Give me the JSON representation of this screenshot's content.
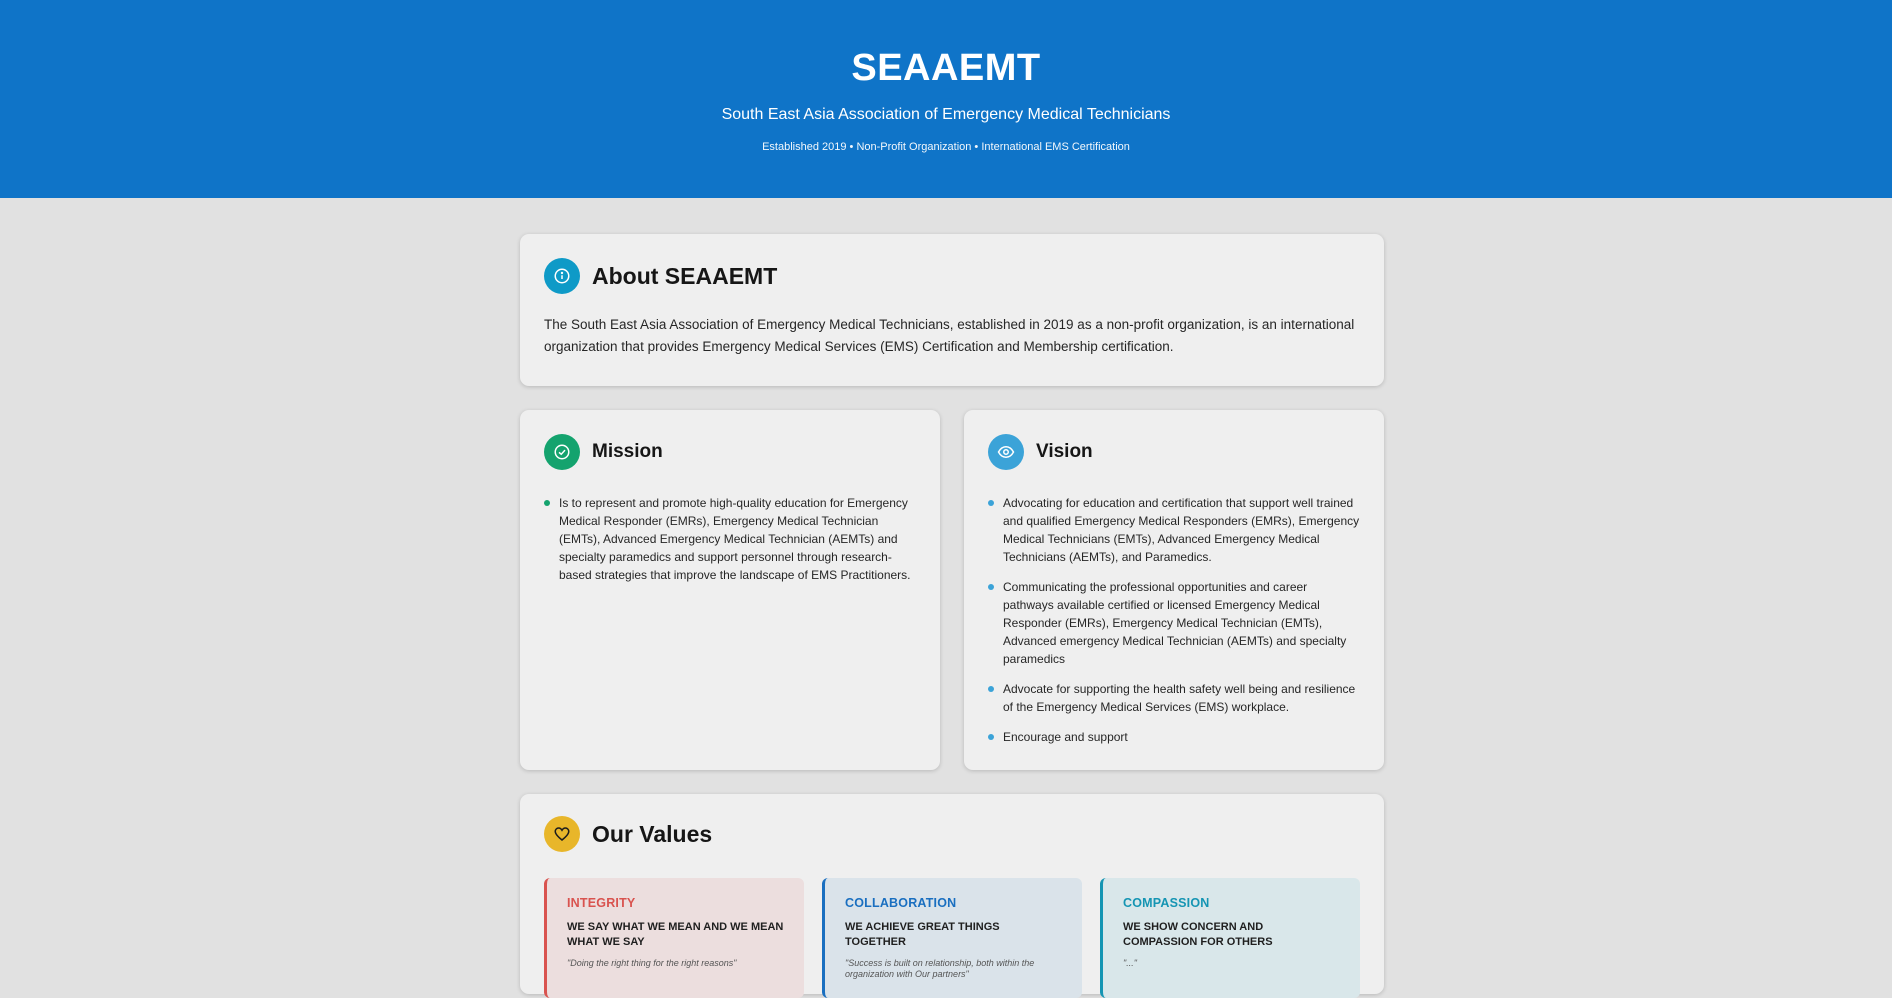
{
  "header": {
    "title": "SEAAEMT",
    "subtitle": "South East Asia Association of Emergency Medical Technicians",
    "meta": "Established 2019 • Non-Profit Organization • International EMS Certification"
  },
  "about": {
    "title": "About SEAAEMT",
    "text": "The South East Asia Association of Emergency Medical Technicians, established in 2019 as a non-profit organization, is an international organization that provides Emergency Medical Services (EMS) Certification and Membership certification."
  },
  "mission": {
    "title": "Mission",
    "items": [
      "Is to represent and promote high-quality education for Emergency Medical Responder (EMRs), Emergency Medical Technician (EMTs), Advanced Emergency Medical Technician (AEMTs) and specialty paramedics and support personnel through research-based strategies that improve the landscape of EMS Practitioners."
    ]
  },
  "vision": {
    "title": "Vision",
    "items": [
      "Advocating for education and certification that support well trained and qualified Emergency Medical Responders (EMRs), Emergency Medical Technicians (EMTs), Advanced Emergency Medical Technicians (AEMTs), and Paramedics.",
      "Communicating the professional opportunities and career pathways available certified or licensed Emergency Medical Responder (EMRs), Emergency Medical Technician (EMTs), Advanced emergency Medical Technician (AEMTs) and specialty paramedics",
      "Advocate for supporting the health safety well being and resilience of the Emergency Medical Services (EMS) workplace.",
      "Encourage and support"
    ]
  },
  "values": {
    "title": "Our Values",
    "items": [
      {
        "name": "INTEGRITY",
        "tagline": "WE SAY WHAT WE MEAN AND WE MEAN WHAT WE SAY",
        "quote": "\"Doing the right thing for the right reasons\""
      },
      {
        "name": "COLLABORATION",
        "tagline": "WE ACHIEVE GREAT THINGS TOGETHER",
        "quote": "\"Success is built on relationship, both within the organization with Our partners\""
      },
      {
        "name": "COMPASSION",
        "tagline": "WE SHOW CONCERN AND COMPASSION FOR OTHERS",
        "quote": "\"...\""
      }
    ]
  },
  "icons": {
    "about": "info-icon",
    "mission": "check-circle-icon",
    "vision": "eye-icon",
    "values": "heart-icon"
  },
  "colors": {
    "header_bg": "#0f74c8",
    "about_icon": "#0e9ac7",
    "mission_icon": "#14a36e",
    "vision_icon": "#3ba3d8",
    "values_icon": "#e8b62a",
    "integrity": "#d9534f",
    "collaboration": "#1a6fc0",
    "compassion": "#1595b3"
  }
}
